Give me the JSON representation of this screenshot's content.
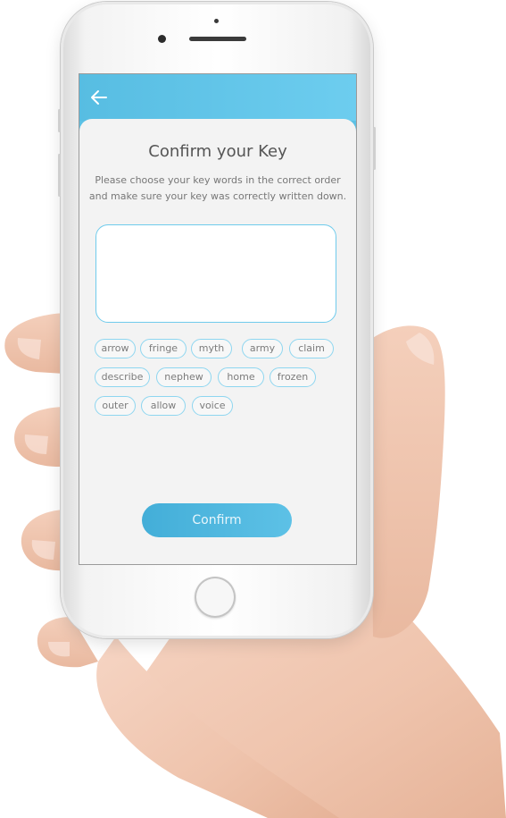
{
  "screen": {
    "title": "Confirm your Key",
    "subtitle": "Please choose your key words in the correct order and make sure your key was correctly written down.",
    "key_input_value": "",
    "back_icon": "arrow-left-icon",
    "confirm_label": "Confirm"
  },
  "words": [
    {
      "label": "arrow"
    },
    {
      "label": "fringe"
    },
    {
      "label": "myth"
    },
    {
      "label": "army"
    },
    {
      "label": "claim"
    },
    {
      "label": "describe"
    },
    {
      "label": "nephew"
    },
    {
      "label": "home"
    },
    {
      "label": "frozen"
    },
    {
      "label": "outer"
    },
    {
      "label": "allow"
    },
    {
      "label": "voice"
    }
  ],
  "colors": {
    "accent": "#5cc1e5",
    "button": "#43aed8",
    "chip_border": "#8ed6f0",
    "card_bg": "#f3f3f3"
  }
}
